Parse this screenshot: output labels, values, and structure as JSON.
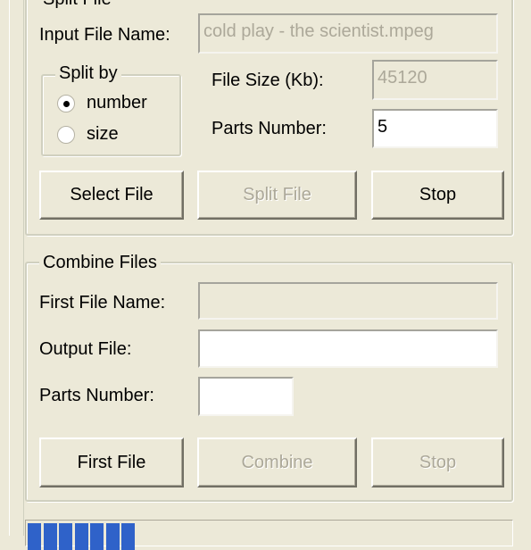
{
  "split": {
    "group_label": "Split File",
    "input_label": "Input File Name:",
    "input_value": "cold play - the scientist.mpeg",
    "split_by": {
      "label": "Split by",
      "options": [
        {
          "label": "number",
          "checked": true
        },
        {
          "label": "size",
          "checked": false
        }
      ]
    },
    "file_size_label": "File Size (Kb):",
    "file_size_value": "45120",
    "parts_label": "Parts Number:",
    "parts_value": "5",
    "buttons": {
      "select": "Select File",
      "split": "Split File",
      "stop": "Stop"
    }
  },
  "combine": {
    "group_label": "Combine Files",
    "first_label": "First File Name:",
    "first_value": "",
    "output_label": "Output File:",
    "output_value": "",
    "parts_label": "Parts Number:",
    "parts_value": "",
    "buttons": {
      "first": "First File",
      "combine": "Combine",
      "stop": "Stop"
    }
  },
  "progress": {
    "percent": 22,
    "color": "#2f62c9"
  }
}
